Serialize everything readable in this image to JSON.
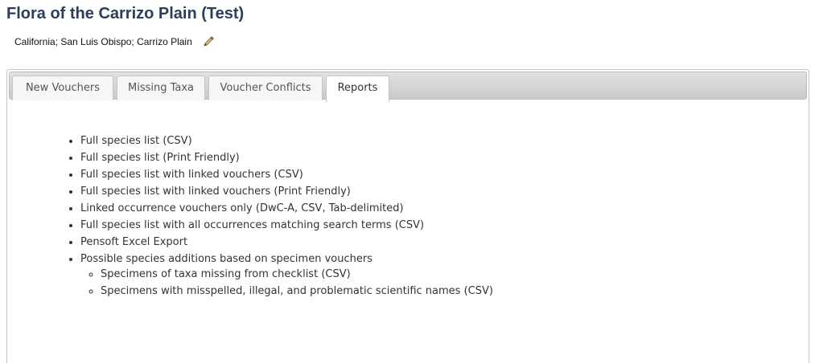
{
  "header": {
    "title": "Flora of the Carrizo Plain (Test)",
    "locality": "California; San Luis Obispo; Carrizo Plain",
    "edit_icon": "pencil-icon"
  },
  "tabs": [
    {
      "label": "New Vouchers",
      "active": false
    },
    {
      "label": "Missing Taxa",
      "active": false
    },
    {
      "label": "Voucher Conflicts",
      "active": false
    },
    {
      "label": "Reports",
      "active": true
    }
  ],
  "reports": {
    "items": [
      "Full species list (CSV)",
      "Full species list (Print Friendly)",
      "Full species list with linked vouchers (CSV)",
      "Full species list with linked vouchers (Print Friendly)",
      "Linked occurrence vouchers only (DwC-A, CSV, Tab-delimited)",
      "Full species list with all occurrences matching search terms (CSV)",
      "Pensoft Excel Export",
      "Possible species additions based on specimen vouchers"
    ],
    "sub_items": [
      "Specimens of taxa missing from checklist (CSV)",
      "Specimens with misspelled, illegal, and problematic scientific names (CSV)"
    ]
  }
}
